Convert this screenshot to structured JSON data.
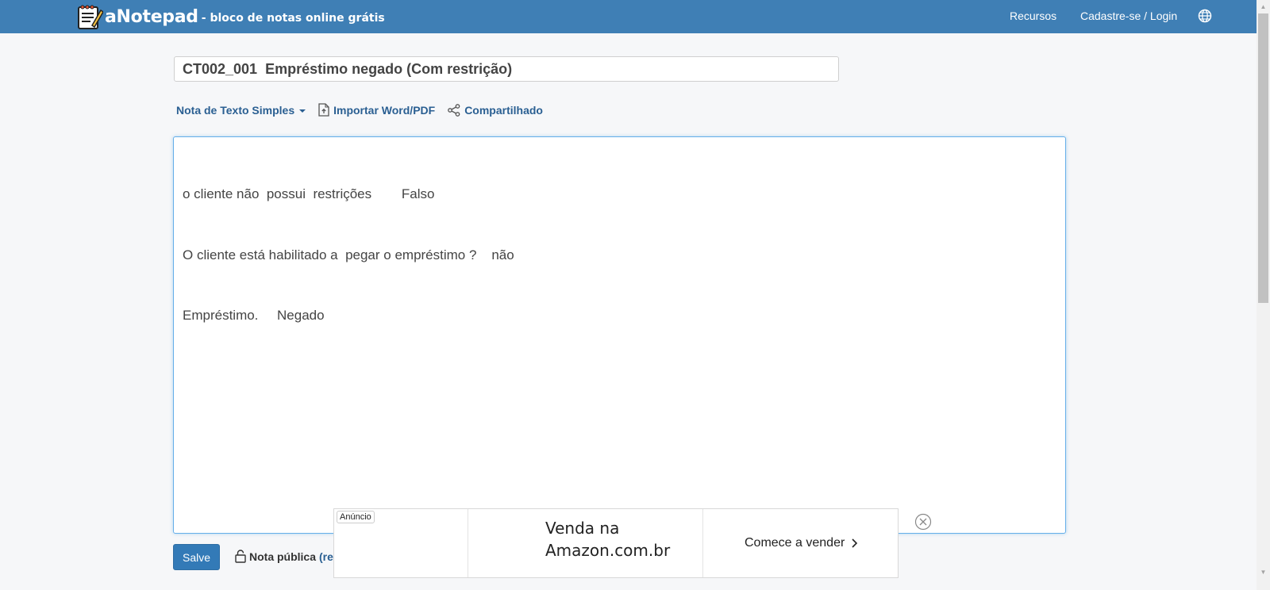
{
  "header": {
    "brand_name": "aNotepad",
    "brand_tagline": "- bloco de notas online grátis",
    "nav": {
      "resources": "Recursos",
      "signup_login": "Cadastre-se / Login"
    },
    "bg_color": "#3f7fb5"
  },
  "note": {
    "title": "CT002_001  Empréstimo negado (Com restrição)",
    "toolbar": {
      "note_type": "Nota de Texto Simples",
      "import": "Importar Word/PDF",
      "share": "Compartilhado"
    },
    "lines": [
      "o cliente não  possui  restrições        Falso",
      "O cliente está habilitado a  pegar o empréstimo ?    não",
      "Empréstimo.     Negado"
    ],
    "save_label": "Salve",
    "visibility_label": "Nota pública",
    "visibility_link": "(re"
  },
  "ad": {
    "badge": "Anúncio",
    "headline_1": "Venda na",
    "headline_2": "Amazon.com.br",
    "cta": "Comece a vender"
  },
  "colors": {
    "accent": "#337ab7",
    "link": "#2a5f92",
    "page_bg": "#f6f7f9"
  }
}
